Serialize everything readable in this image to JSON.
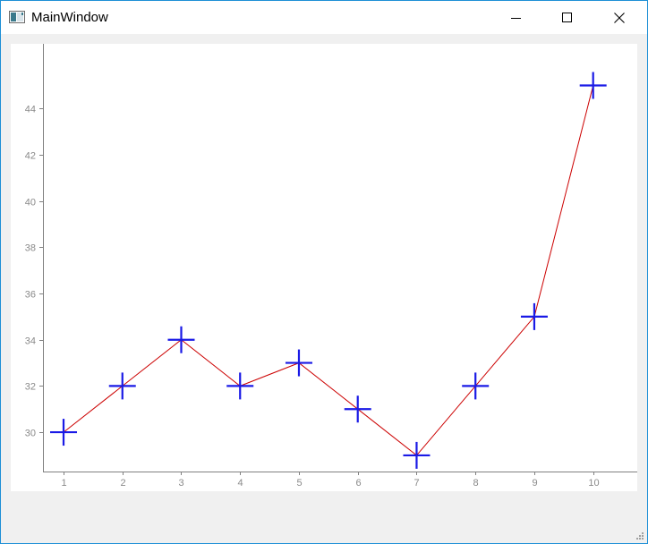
{
  "window": {
    "title": "MainWindow",
    "icons": {
      "app": "app-window-icon",
      "minimize": "minimize-icon",
      "maximize": "maximize-icon",
      "close": "close-icon",
      "grip": "size-grip-icon"
    }
  },
  "colors": {
    "line": "#cc0000",
    "marker": "#1a1ae6",
    "axis": "#808080",
    "tick_label": "#8a8a8a"
  },
  "chart_data": {
    "type": "line",
    "x": [
      1,
      2,
      3,
      4,
      5,
      6,
      7,
      8,
      9,
      10
    ],
    "series": [
      {
        "values": [
          30,
          32,
          34,
          32,
          33,
          31,
          29,
          32,
          35,
          45
        ]
      }
    ],
    "x_ticks": [
      1,
      2,
      3,
      4,
      5,
      6,
      7,
      8,
      9,
      10
    ],
    "y_ticks": [
      30,
      32,
      34,
      36,
      38,
      40,
      42,
      44
    ],
    "xlim": [
      0.65,
      10.75
    ],
    "ylim": [
      28.3,
      46.8
    ],
    "marker": "cross",
    "grid": false,
    "title": "",
    "xlabel": "",
    "ylabel": ""
  }
}
